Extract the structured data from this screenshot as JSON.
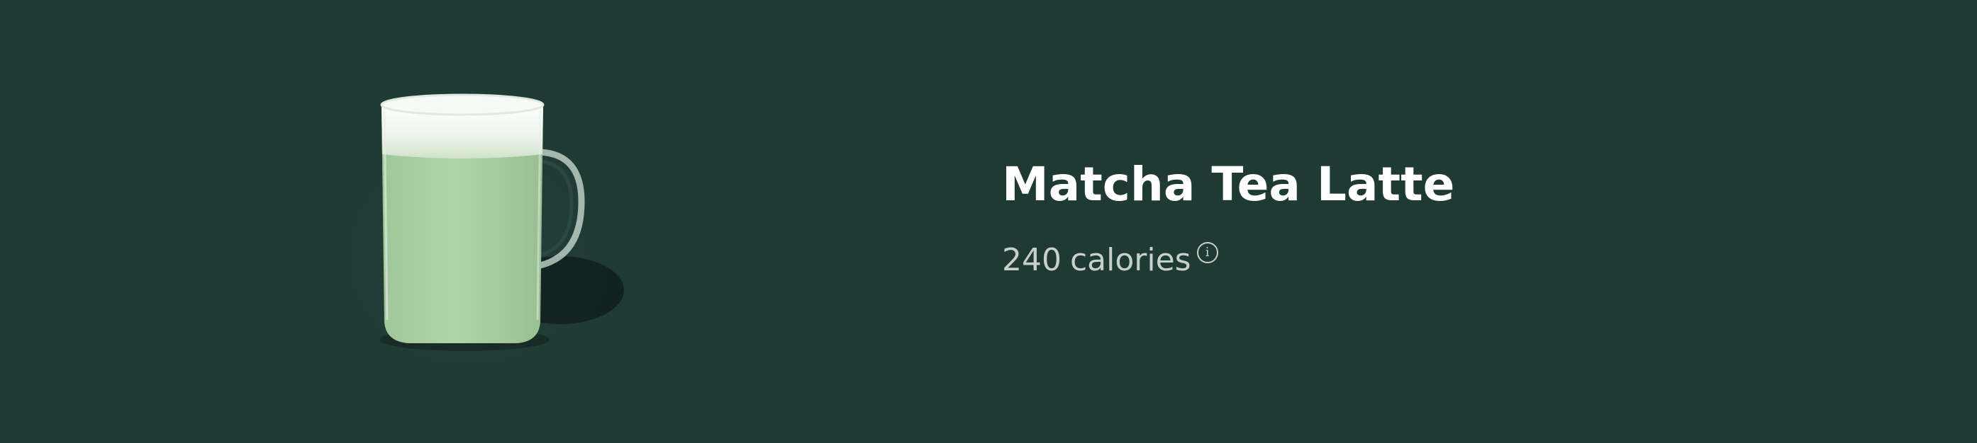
{
  "product": {
    "name": "Matcha Tea Latte",
    "calories_value": "240",
    "calories_unit": "calories",
    "info_icon_glyph": "i",
    "image_icon": "glass-mug-icon"
  },
  "colors": {
    "background": "#1f3933",
    "title": "#ffffff",
    "subtext": "#c8cfcc",
    "matcha_green": "#a7cda0",
    "foam": "#eef4ec"
  }
}
